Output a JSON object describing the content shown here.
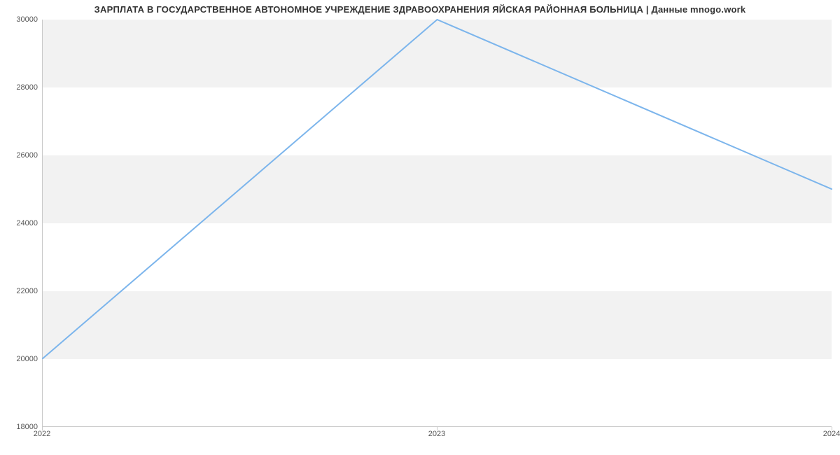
{
  "chart_data": {
    "type": "line",
    "title": "ЗАРПЛАТА В ГОСУДАРСТВЕННОЕ АВТОНОМНОЕ УЧРЕЖДЕНИЕ ЗДРАВООХРАНЕНИЯ  ЯЙСКАЯ РАЙОННАЯ БОЛЬНИЦА | Данные mnogo.work",
    "x": [
      2022,
      2023,
      2024
    ],
    "values": [
      20000,
      30000,
      25000
    ],
    "xlabel": "",
    "ylabel": "",
    "xlim": [
      2022,
      2024
    ],
    "ylim": [
      18000,
      30000
    ],
    "y_ticks": [
      18000,
      20000,
      22000,
      24000,
      26000,
      28000,
      30000
    ],
    "x_ticks": [
      2022,
      2023,
      2024
    ],
    "line_color": "#7cb5ec",
    "band_color": "#f2f2f2"
  }
}
